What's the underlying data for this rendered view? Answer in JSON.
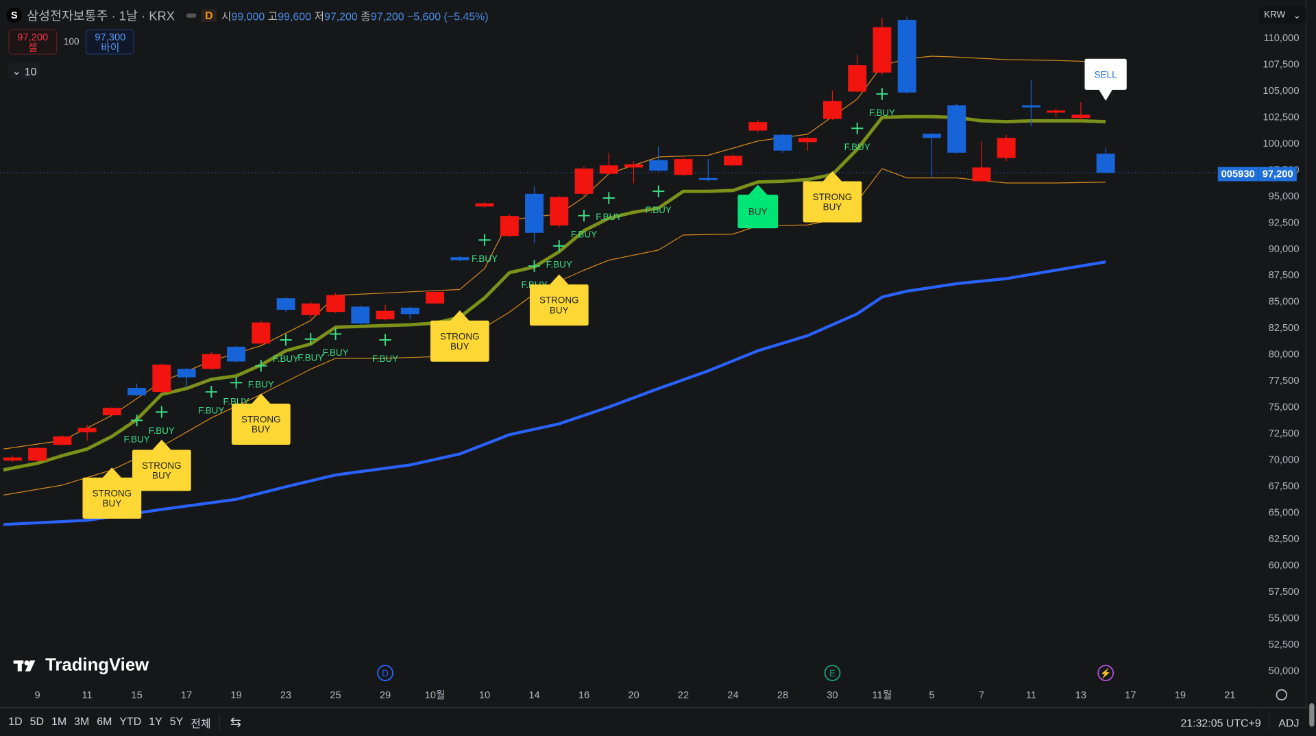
{
  "header": {
    "symbol_badge": "S",
    "title": "삼성전자보통주 · 1날 · KRX",
    "interval_badge": "D",
    "open_label": "시",
    "open": "99,000",
    "high_label": "고",
    "high": "99,600",
    "low_label": "저",
    "low": "97,200",
    "close_label": "종",
    "close": "97,200",
    "change": "−5,600 (−5.45%)"
  },
  "trade": {
    "sell_price": "97,200",
    "sell_label": "셀",
    "quantity": "100",
    "buy_price": "97,300",
    "buy_label": "바이"
  },
  "collapse": {
    "icon": "chevron-down-icon",
    "count": "10"
  },
  "currency": "KRW",
  "last_price": {
    "ticker": "005930",
    "price": "97,200",
    "value": 97200
  },
  "logo": "TradingView",
  "bottom": {
    "ranges": [
      "1D",
      "5D",
      "1M",
      "3M",
      "6M",
      "YTD",
      "1Y",
      "5Y",
      "전체"
    ],
    "clock": "21:32:05 UTC+9",
    "adj": "ADJ"
  },
  "colors": {
    "up": "#f2150f",
    "down": "#1764d8",
    "ma": "#7c901a",
    "band": "#d68a1f",
    "long_ma": "#2962ff",
    "strong_buy": "#fdd835",
    "buy": "#00e676",
    "sell": "#ffffff",
    "fbuy": "#3ddc84"
  },
  "chart_data": {
    "type": "candlestick",
    "ylim": [
      50000,
      110000
    ],
    "y_ticks": [
      "110,000",
      "107,500",
      "105,000",
      "102,500",
      "100,000",
      "97,500",
      "95,000",
      "92,500",
      "90,000",
      "87,500",
      "85,000",
      "82,500",
      "80,000",
      "77,500",
      "75,000",
      "72,500",
      "70,000",
      "67,500",
      "65,000",
      "62,500",
      "60,000",
      "57,500",
      "55,000",
      "52,500",
      "50,000"
    ],
    "x_ticks": [
      {
        "i": 1,
        "label": "9"
      },
      {
        "i": 3,
        "label": "11"
      },
      {
        "i": 5,
        "label": "15"
      },
      {
        "i": 7,
        "label": "17"
      },
      {
        "i": 9,
        "label": "19"
      },
      {
        "i": 11,
        "label": "23"
      },
      {
        "i": 13,
        "label": "25"
      },
      {
        "i": 15,
        "label": "29"
      },
      {
        "i": 17,
        "label": "10월"
      },
      {
        "i": 19,
        "label": "10"
      },
      {
        "i": 21,
        "label": "14"
      },
      {
        "i": 23,
        "label": "16"
      },
      {
        "i": 25,
        "label": "20"
      },
      {
        "i": 27,
        "label": "22"
      },
      {
        "i": 29,
        "label": "24"
      },
      {
        "i": 31,
        "label": "28"
      },
      {
        "i": 33,
        "label": "30"
      },
      {
        "i": 35,
        "label": "11월"
      },
      {
        "i": 37,
        "label": "5"
      },
      {
        "i": 39,
        "label": "7"
      },
      {
        "i": 41,
        "label": "11"
      },
      {
        "i": 43,
        "label": "13"
      },
      {
        "i": 45,
        "label": "17"
      },
      {
        "i": 47,
        "label": "19"
      },
      {
        "i": 49,
        "label": "21"
      }
    ],
    "candles": [
      [
        69900,
        70200,
        70400,
        69800
      ],
      [
        69900,
        71100,
        71200,
        69800
      ],
      [
        71400,
        72200,
        72300,
        71300
      ],
      [
        72600,
        73000,
        73300,
        71800
      ],
      [
        74200,
        74900,
        75000,
        74100
      ],
      [
        76800,
        76100,
        77200,
        76000
      ],
      [
        76400,
        79000,
        79100,
        76300
      ],
      [
        78600,
        77800,
        78700,
        76800
      ],
      [
        78600,
        80000,
        80200,
        78500
      ],
      [
        80700,
        79300,
        80800,
        79200
      ],
      [
        81000,
        83000,
        83200,
        80900
      ],
      [
        85300,
        84200,
        85400,
        84000
      ],
      [
        83700,
        84800,
        85000,
        83300
      ],
      [
        84000,
        85600,
        85800,
        83900
      ],
      [
        84500,
        82900,
        84600,
        82700
      ],
      [
        83300,
        84100,
        84700,
        83200
      ],
      [
        84400,
        83800,
        84500,
        83300
      ],
      [
        84800,
        85900,
        86000,
        84700
      ],
      [
        89200,
        88900,
        89300,
        88800
      ],
      [
        94000,
        94300,
        94400,
        93900
      ],
      [
        91200,
        93100,
        93300,
        91100
      ],
      [
        95200,
        91500,
        95900,
        90500
      ],
      [
        92200,
        94900,
        95000,
        92000
      ],
      [
        95200,
        97600,
        97800,
        95000
      ],
      [
        97100,
        97900,
        99100,
        97000
      ],
      [
        97700,
        98000,
        98300,
        96200
      ],
      [
        98400,
        97400,
        99700,
        97300
      ],
      [
        97000,
        98500,
        98600,
        96900
      ],
      [
        96700,
        96500,
        98500,
        96400
      ],
      [
        97900,
        98800,
        99000,
        97800
      ],
      [
        101200,
        102000,
        102200,
        101000
      ],
      [
        100800,
        99300,
        100900,
        99100
      ],
      [
        100100,
        100500,
        100600,
        99300
      ],
      [
        102300,
        104000,
        105000,
        102200
      ],
      [
        104900,
        107400,
        108400,
        104800
      ],
      [
        106700,
        111000,
        111900,
        106500
      ],
      [
        111700,
        104800,
        112000,
        104700
      ],
      [
        100900,
        100500,
        101000,
        96800
      ],
      [
        103600,
        99100,
        103700,
        99000
      ],
      [
        96400,
        97700,
        100200,
        96300
      ],
      [
        98600,
        100500,
        100800,
        98300
      ],
      [
        103600,
        103400,
        106000,
        101600
      ],
      [
        102900,
        103100,
        103300,
        102500
      ],
      [
        102400,
        102700,
        103900,
        102200
      ],
      [
        99000,
        97200,
        99600,
        97100
      ]
    ],
    "series": [
      {
        "key": "ma",
        "points": [
          [
            0,
            69020
          ],
          [
            1,
            69650
          ],
          [
            2,
            70370
          ],
          [
            3,
            71000
          ],
          [
            4,
            72200
          ],
          [
            5,
            73790
          ],
          [
            6,
            76180
          ],
          [
            7,
            76740
          ],
          [
            8,
            77610
          ],
          [
            9,
            77930
          ],
          [
            10,
            78970
          ],
          [
            11,
            80320
          ],
          [
            12,
            80960
          ],
          [
            13,
            82550
          ],
          [
            14,
            82630
          ],
          [
            15,
            82710
          ],
          [
            16,
            82780
          ],
          [
            17,
            82940
          ],
          [
            18,
            83500
          ],
          [
            19,
            85330
          ],
          [
            20,
            87720
          ],
          [
            21,
            88270
          ],
          [
            22,
            89710
          ],
          [
            23,
            91700
          ],
          [
            24,
            92890
          ],
          [
            25,
            93450
          ],
          [
            26,
            93850
          ],
          [
            27,
            95440
          ],
          [
            28,
            95440
          ],
          [
            29,
            95520
          ],
          [
            30,
            96320
          ],
          [
            31,
            96390
          ],
          [
            32,
            96550
          ],
          [
            33,
            97030
          ],
          [
            34,
            99420
          ],
          [
            35,
            102440
          ],
          [
            36,
            102520
          ],
          [
            37,
            102520
          ],
          [
            38,
            102440
          ],
          [
            39,
            102120
          ],
          [
            40,
            102040
          ],
          [
            41,
            102120
          ],
          [
            42,
            102120
          ],
          [
            43,
            102120
          ],
          [
            44,
            102040
          ]
        ]
      },
      {
        "key": "upper",
        "points": [
          [
            0,
            71000
          ],
          [
            2,
            71800
          ],
          [
            4,
            74190
          ],
          [
            6,
            77370
          ],
          [
            8,
            79360
          ],
          [
            10,
            80790
          ],
          [
            12,
            83180
          ],
          [
            13,
            85570
          ],
          [
            18,
            86130
          ],
          [
            19,
            88120
          ],
          [
            20,
            92730
          ],
          [
            22,
            93290
          ],
          [
            23,
            94880
          ],
          [
            24,
            97110
          ],
          [
            26,
            98700
          ],
          [
            28,
            98860
          ],
          [
            30,
            100210
          ],
          [
            32,
            100850
          ],
          [
            34,
            104190
          ],
          [
            35,
            107370
          ],
          [
            36,
            108010
          ],
          [
            37,
            108250
          ],
          [
            38,
            108170
          ],
          [
            40,
            107930
          ],
          [
            42,
            107850
          ],
          [
            44,
            107690
          ]
        ]
      },
      {
        "key": "lower",
        "points": [
          [
            0,
            66630
          ],
          [
            2,
            67580
          ],
          [
            4,
            69020
          ],
          [
            6,
            71250
          ],
          [
            8,
            73950
          ],
          [
            10,
            76180
          ],
          [
            12,
            78570
          ],
          [
            13,
            79600
          ],
          [
            15,
            79600
          ],
          [
            17,
            79760
          ],
          [
            18,
            80720
          ],
          [
            19,
            82550
          ],
          [
            20,
            83980
          ],
          [
            21,
            85730
          ],
          [
            22,
            86920
          ],
          [
            23,
            87960
          ],
          [
            24,
            88910
          ],
          [
            26,
            89870
          ],
          [
            27,
            91300
          ],
          [
            29,
            91380
          ],
          [
            30,
            92170
          ],
          [
            32,
            92250
          ],
          [
            33,
            92730
          ],
          [
            34,
            94480
          ],
          [
            35,
            97590
          ],
          [
            36,
            96710
          ],
          [
            38,
            96710
          ],
          [
            40,
            96230
          ],
          [
            42,
            96230
          ],
          [
            44,
            96310
          ]
        ]
      },
      {
        "key": "long_ma",
        "points": [
          [
            0,
            63840
          ],
          [
            3,
            64240
          ],
          [
            6,
            65270
          ],
          [
            9,
            66230
          ],
          [
            11,
            67420
          ],
          [
            13,
            68540
          ],
          [
            16,
            69490
          ],
          [
            18,
            70530
          ],
          [
            20,
            72360
          ],
          [
            22,
            73390
          ],
          [
            24,
            74980
          ],
          [
            26,
            76730
          ],
          [
            28,
            78410
          ],
          [
            30,
            80320
          ],
          [
            32,
            81750
          ],
          [
            34,
            83820
          ],
          [
            35,
            85410
          ],
          [
            36,
            85970
          ],
          [
            38,
            86680
          ],
          [
            40,
            87160
          ],
          [
            42,
            87960
          ],
          [
            44,
            88750
          ]
        ]
      }
    ],
    "signals": [
      {
        "type": "fbuy",
        "i": 5,
        "price": 73710,
        "label": "F.BUY"
      },
      {
        "type": "fbuy",
        "i": 6,
        "price": 74510,
        "label": "F.BUY"
      },
      {
        "type": "fbuy",
        "i": 8,
        "price": 76420,
        "label": "F.BUY"
      },
      {
        "type": "fbuy",
        "i": 9,
        "price": 77290,
        "label": "F.BUY"
      },
      {
        "type": "fbuy",
        "i": 10,
        "price": 78890,
        "label": "F.BUY"
      },
      {
        "type": "fbuy",
        "i": 11,
        "price": 81350,
        "label": "F.BUY"
      },
      {
        "type": "fbuy",
        "i": 12,
        "price": 81430,
        "label": "F.BUY"
      },
      {
        "type": "fbuy",
        "i": 13,
        "price": 81910,
        "label": "F.BUY"
      },
      {
        "type": "fbuy",
        "i": 15,
        "price": 81350,
        "label": "F.BUY"
      },
      {
        "type": "fbuy",
        "i": 19,
        "price": 90820,
        "label": "F.BUY"
      },
      {
        "type": "fbuy",
        "i": 21,
        "price": 88350,
        "label": "F.BUY"
      },
      {
        "type": "fbuy",
        "i": 22,
        "price": 90260,
        "label": "F.BUY"
      },
      {
        "type": "fbuy",
        "i": 23,
        "price": 93130,
        "label": "F.BUY"
      },
      {
        "type": "fbuy",
        "i": 24,
        "price": 94800,
        "label": "F.BUY"
      },
      {
        "type": "fbuy",
        "i": 26,
        "price": 95440,
        "label": "F.BUY"
      },
      {
        "type": "fbuy",
        "i": 34,
        "price": 101410,
        "label": "F.BUY"
      },
      {
        "type": "fbuy",
        "i": 35,
        "price": 104670,
        "label": "F.BUY"
      },
      {
        "type": "strong_buy",
        "i": 4,
        "price": 69250,
        "label": [
          "STRONG",
          "BUY"
        ]
      },
      {
        "type": "strong_buy",
        "i": 6,
        "price": 71880,
        "label": [
          "STRONG",
          "BUY"
        ]
      },
      {
        "type": "strong_buy",
        "i": 10,
        "price": 76260,
        "label": [
          "STRONG",
          "BUY"
        ]
      },
      {
        "type": "strong_buy",
        "i": 18,
        "price": 84140,
        "label": [
          "STRONG",
          "BUY"
        ]
      },
      {
        "type": "strong_buy",
        "i": 22,
        "price": 87560,
        "label": [
          "STRONG",
          "BUY"
        ]
      },
      {
        "type": "strong_buy",
        "i": 33,
        "price": 97350,
        "label": [
          "STRONG",
          "BUY"
        ]
      },
      {
        "type": "buy",
        "i": 30,
        "price": 96070,
        "label": [
          "BUY"
        ]
      },
      {
        "type": "sell",
        "i": 44,
        "price": 104030,
        "label": [
          "SELL"
        ]
      }
    ],
    "events": [
      {
        "i": 15,
        "label": "D",
        "color": "#2962ff"
      },
      {
        "i": 33,
        "label": "E",
        "color": "#1e9e7a"
      },
      {
        "i": 44,
        "label": "⚡",
        "color": "#b14fd8"
      }
    ]
  }
}
